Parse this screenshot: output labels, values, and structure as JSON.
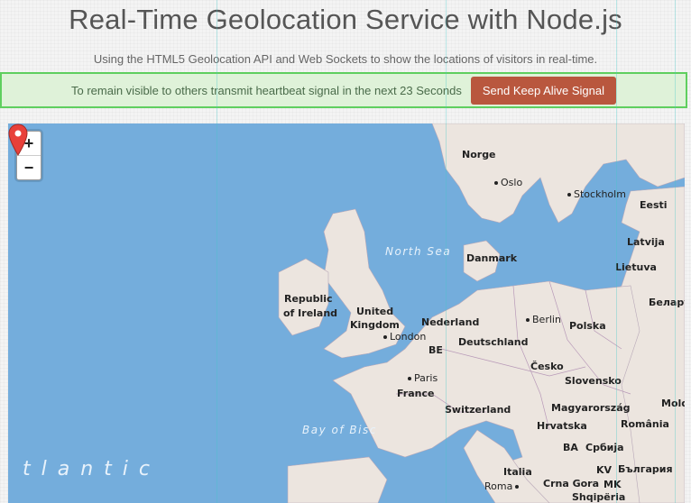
{
  "header": {
    "title": "Real-Time Geolocation Service with Node.js",
    "subtitle": "Using the HTML5 Geolocation API and Web Sockets to show the locations of visitors in real-time."
  },
  "alert": {
    "message": "To remain visible to others transmit heartbeat signal in the next 23 Seconds",
    "button_label": "Send Keep Alive Signal"
  },
  "map": {
    "zoom_in": "+",
    "zoom_out": "−",
    "labels": {
      "norge": "Norge",
      "oslo": "Oslo",
      "stockholm": "Stockholm",
      "eesti": "Eesti",
      "latvija": "Latvija",
      "lietuva": "Lietuva",
      "belarus": "Белару",
      "north_sea": "North Sea",
      "danmark": "Danmark",
      "ireland_1": "Republic",
      "ireland_2": "of Ireland",
      "uk_1": "United",
      "uk_2": "Kingdom",
      "london": "London",
      "nederland": "Nederland",
      "berlin": "Berlin",
      "polska": "Polska",
      "be": "BE",
      "deutschland": "Deutschland",
      "cesko": "Česko",
      "paris": "Paris",
      "france": "France",
      "slovensko": "Slovensko",
      "switzerland": "Switzerland",
      "magyarorszag": "Magyarország",
      "moldova": "Moldo",
      "bay_of_biscay": "Bay of Bisc",
      "hrvatska": "Hrvatska",
      "romania": "România",
      "ba": "BA",
      "srbija": "Србија",
      "atlantic": "tlantic",
      "italia": "Italia",
      "kv": "KV",
      "bulgaria": "България",
      "roma": "Roma",
      "crna_gora": "Crna Gora",
      "mk": "MK",
      "shqiperia": "Shqipëria"
    }
  },
  "colors": {
    "sea": "#74addc",
    "land": "#ece5df",
    "alert_border": "#5fcf5f",
    "alert_bg": "#dff2d9",
    "button_bg": "#b9573e",
    "marker": "#e8403a"
  }
}
